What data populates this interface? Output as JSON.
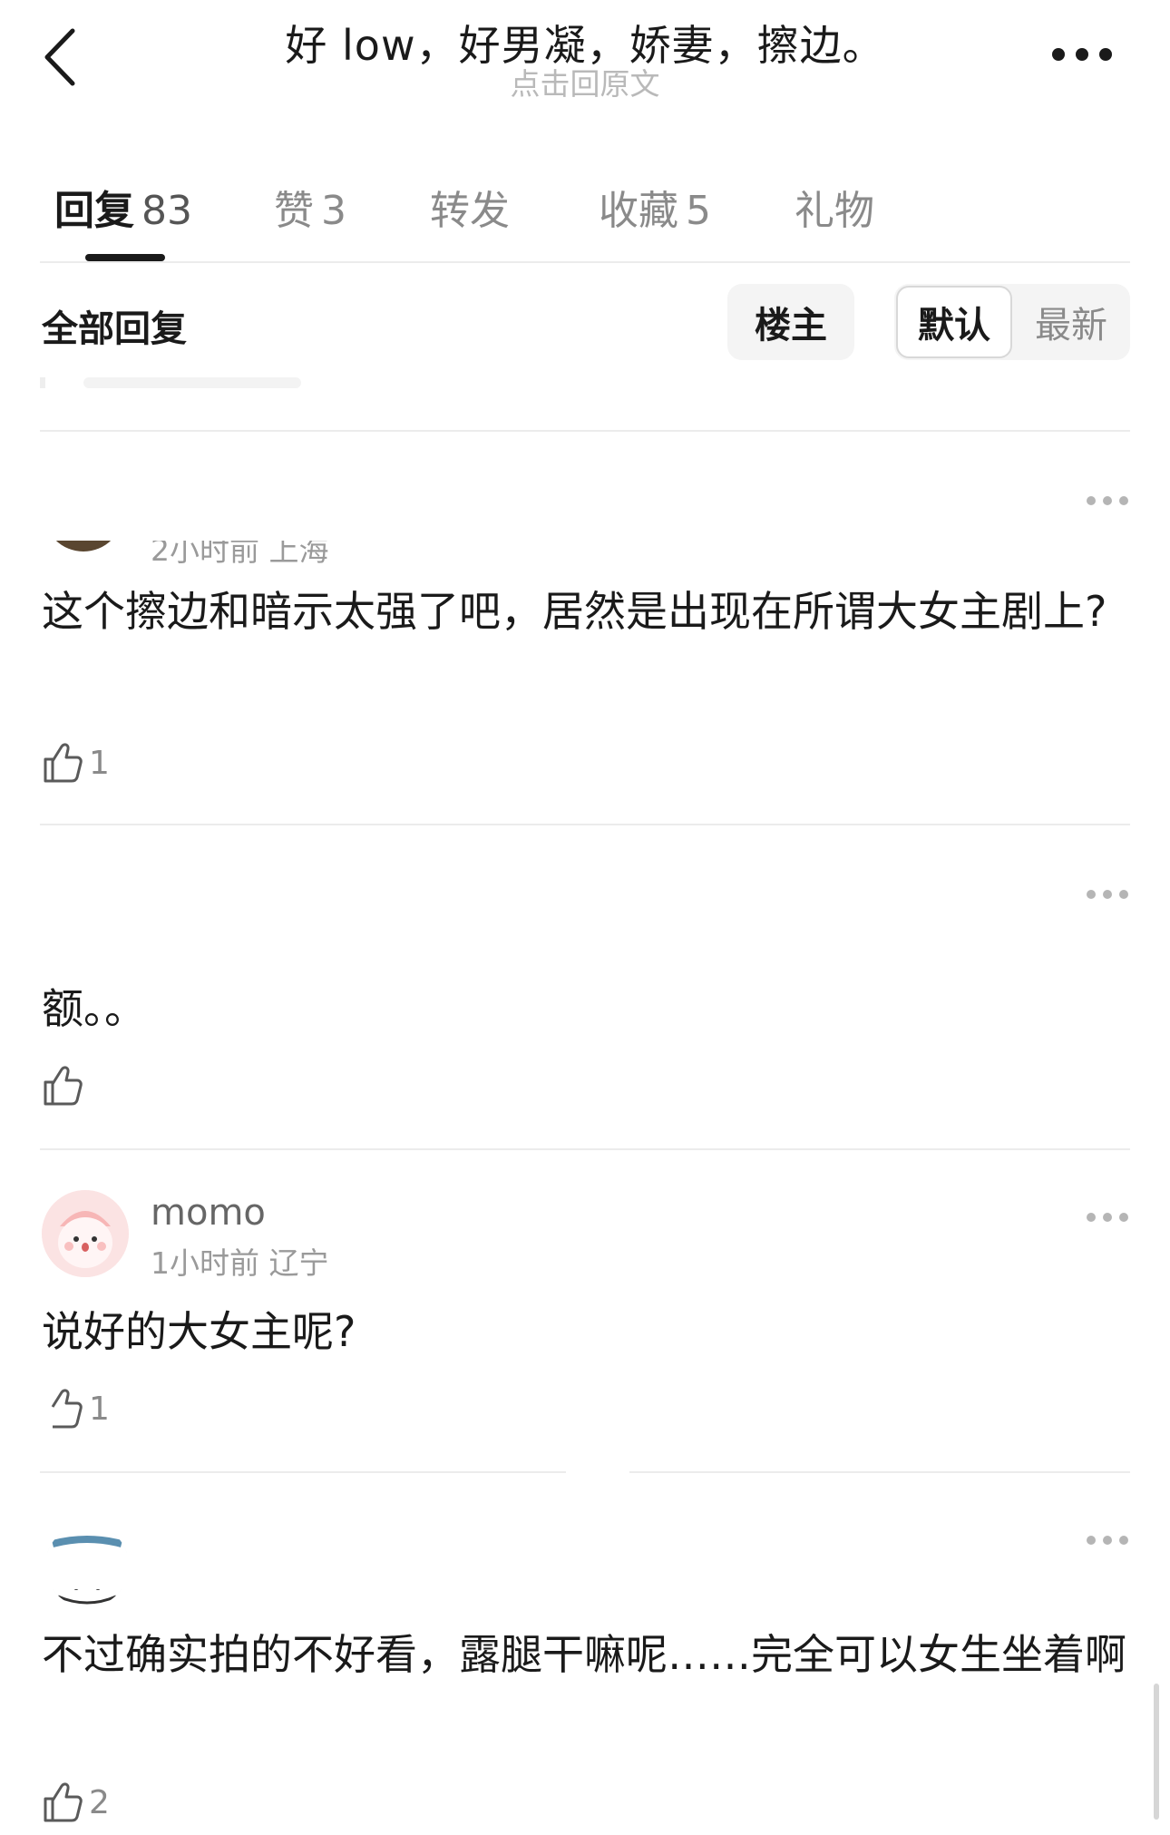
{
  "header": {
    "title": "好 low，好男凝，娇妻，擦边。",
    "subtitle": "点击回原文"
  },
  "tabs": [
    {
      "label": "回复",
      "count": "83"
    },
    {
      "label": "赞",
      "count": "3"
    },
    {
      "label": "转发",
      "count": ""
    },
    {
      "label": "收藏",
      "count": "5"
    },
    {
      "label": "礼物",
      "count": ""
    }
  ],
  "filter": {
    "title": "全部回复",
    "owner_label": "楼主",
    "sort_default": "默认",
    "sort_latest": "最新"
  },
  "comments": [
    {
      "user": "",
      "meta": "2小时前 上海",
      "text": "这个擦边和暗示太强了吧，居然是出现在所谓大女主剧上?",
      "likes": "1"
    },
    {
      "user": "",
      "meta": "",
      "text": "额。。",
      "likes": ""
    },
    {
      "user": "momo",
      "meta": "1小时前 辽宁",
      "text": "说好的大女主呢?",
      "likes": "1"
    },
    {
      "user": "",
      "meta": "",
      "text": "不过确实拍的不好看，露腿干嘛呢……完全可以女生坐着啊",
      "likes": "2"
    }
  ],
  "icons": {
    "back": "chevron-left-icon",
    "more": "more-horizontal-icon",
    "like": "thumbs-up-icon"
  }
}
